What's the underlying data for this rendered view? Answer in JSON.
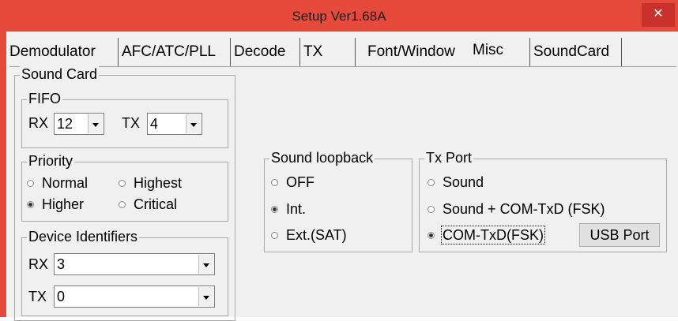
{
  "window": {
    "title": "Setup Ver1.68A",
    "close_glyph": "✕"
  },
  "tabs": [
    {
      "label": "Demodulator"
    },
    {
      "label": "AFC/ATC/PLL"
    },
    {
      "label": "Decode"
    },
    {
      "label": "TX"
    },
    {
      "label": "Font/Window"
    },
    {
      "label": "Misc"
    },
    {
      "label": "SoundCard"
    }
  ],
  "active_tab": "Misc",
  "sound_card": {
    "label": "Sound Card",
    "fifo": {
      "label": "FIFO",
      "rx_label": "RX",
      "rx_value": "12",
      "tx_label": "TX",
      "tx_value": "4"
    },
    "priority": {
      "label": "Priority",
      "options": [
        {
          "label": "Normal",
          "selected": false
        },
        {
          "label": "Highest",
          "selected": false
        },
        {
          "label": "Higher",
          "selected": true
        },
        {
          "label": "Critical",
          "selected": false
        }
      ]
    },
    "device_identifiers": {
      "label": "Device Identifiers",
      "rx_label": "RX",
      "rx_value": "3",
      "tx_label": "TX",
      "tx_value": "0"
    }
  },
  "sound_loopback": {
    "label": "Sound loopback",
    "options": [
      {
        "label": "OFF",
        "selected": false
      },
      {
        "label": "Int.",
        "selected": true
      },
      {
        "label": "Ext.(SAT)",
        "selected": false
      }
    ]
  },
  "tx_port": {
    "label": "Tx Port",
    "options": [
      {
        "label": "Sound",
        "selected": false
      },
      {
        "label": "Sound + COM-TxD (FSK)",
        "selected": false
      },
      {
        "label": "COM-TxD(FSK)",
        "selected": true
      }
    ],
    "usb_port_button": "USB Port"
  },
  "colors": {
    "titlebar": "#e64a3b",
    "client": "#f0f0f0",
    "close": "#c9322c"
  }
}
